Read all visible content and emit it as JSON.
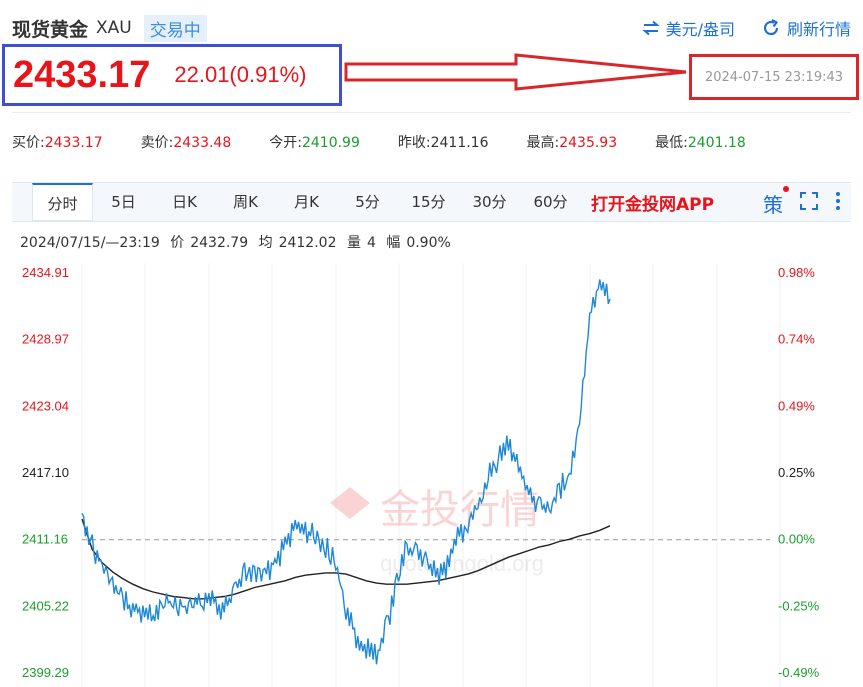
{
  "header": {
    "title": "现货黄金",
    "code": "XAU",
    "status": "交易中"
  },
  "top_actions": {
    "currency": "美元/盎司",
    "refresh": "刷新行情"
  },
  "price": {
    "last": "2433.17",
    "change": "22.01(0.91%)"
  },
  "timestamp": "2024-07-15 23:19:43",
  "quotes": [
    {
      "label": "买价:",
      "value": "2433.17",
      "color": "red"
    },
    {
      "label": "卖价:",
      "value": "2433.48",
      "color": "red"
    },
    {
      "label": "今开:",
      "value": "2410.99",
      "color": "green"
    },
    {
      "label": "昨收:",
      "value": "2411.16",
      "color": "plain"
    },
    {
      "label": "最高:",
      "value": "2435.93",
      "color": "red"
    },
    {
      "label": "最低:",
      "value": "2401.18",
      "color": "green"
    }
  ],
  "tabs": [
    "分时",
    "5日",
    "日K",
    "周K",
    "月K",
    "5分",
    "15分",
    "30分",
    "60分"
  ],
  "promo": "打开金投网APP",
  "strategy_label": "策",
  "info": {
    "time": "2024/07/15/—23:19",
    "price_label": "价",
    "price": "2432.79",
    "avg_label": "均",
    "avg": "2412.02",
    "vol_label": "量",
    "vol": "4",
    "amp_label": "幅",
    "amp": "0.90%"
  },
  "watermark": {
    "name": "金投行情",
    "url": "quote.cngold.org"
  },
  "colors": {
    "up": "#e8141a",
    "down": "#1a9e2c",
    "line": "#1e88d6",
    "avg": "#222222",
    "accent": "#1e6fd6"
  },
  "chart_data": {
    "type": "line",
    "baseline": 2411.16,
    "ylim": [
      2399.29,
      2434.91
    ],
    "y_ticks_left": [
      "2434.91",
      "2428.97",
      "2423.04",
      "2417.10",
      "2411.16",
      "2405.22",
      "2399.29"
    ],
    "y_ticks_right": [
      "0.98%",
      "0.74%",
      "0.49%",
      "0.25%",
      "0.00%",
      "-0.25%",
      "-0.49%"
    ],
    "series": [
      {
        "values_price": [
          2413.5,
          2410.6,
          2408.9,
          2407.2,
          2405.8,
          2405.0,
          2404.6,
          2404.2,
          2405.8,
          2405.6,
          2405.2,
          2405.3,
          2405.8,
          2405.6,
          2404.9,
          2406.8,
          2408.1,
          2408.3,
          2407.9,
          2409.1,
          2410.6,
          2412.3,
          2412.0,
          2411.4,
          2410.5,
          2409.2,
          2404.6,
          2402.6,
          2401.5,
          2400.7,
          2403.3,
          2407.4,
          2410.5,
          2410.2,
          2409.2,
          2408.0,
          2408.7,
          2411.3,
          2412.4,
          2414.2,
          2416.9,
          2418.4,
          2419.7,
          2418.0,
          2415.5,
          2414.1,
          2413.5,
          2415.6,
          2416.9,
          2421.3,
          2431.0,
          2434.2,
          2432.6
        ]
      },
      {
        "values_avg": [
          2413.0,
          2410.3,
          2409.1,
          2408.3,
          2407.7,
          2407.2,
          2406.8,
          2406.5,
          2406.3,
          2406.1,
          2406.0,
          2405.9,
          2405.9,
          2406.0,
          2406.1,
          2406.3,
          2406.6,
          2406.9,
          2407.1,
          2407.3,
          2407.5,
          2407.8,
          2408.0,
          2408.1,
          2408.2,
          2408.2,
          2408.1,
          2407.8,
          2407.5,
          2407.3,
          2407.2,
          2407.2,
          2407.2,
          2407.3,
          2407.4,
          2407.5,
          2407.7,
          2407.9,
          2408.1,
          2408.4,
          2408.8,
          2409.2,
          2409.6,
          2409.9,
          2410.2,
          2410.5,
          2410.7,
          2411.0,
          2411.2,
          2411.5,
          2411.7,
          2412.0,
          2412.4
        ]
      }
    ]
  }
}
